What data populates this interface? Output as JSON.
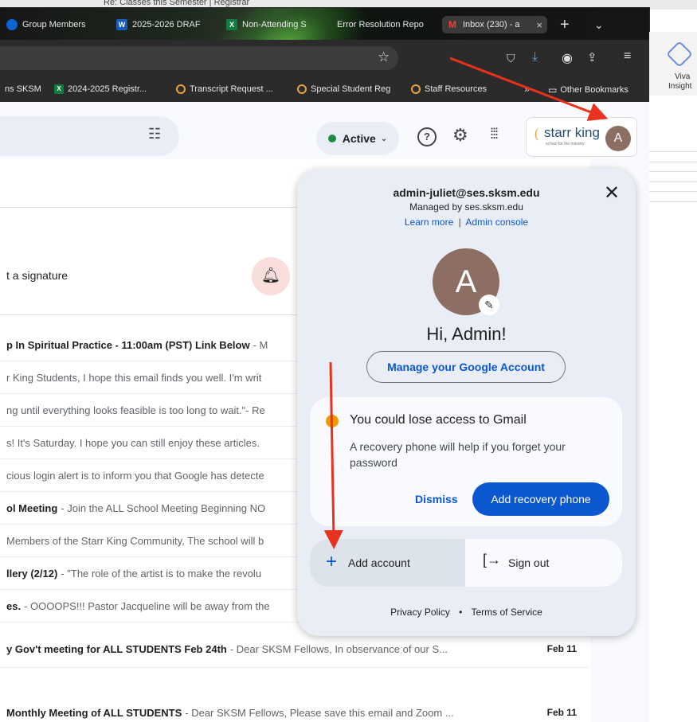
{
  "top_strip_text": "Re: Classes this Semester | Registrar",
  "tabs": [
    {
      "label": "Group Members",
      "icon": "outlook-icon",
      "color": "#0a64d6",
      "letter": ""
    },
    {
      "label": "2025-2026 DRAF",
      "icon": "word-icon",
      "color": "#185abd",
      "letter": "W"
    },
    {
      "label": "Non-Attending S",
      "icon": "excel-icon",
      "color": "#107c41",
      "letter": "X"
    },
    {
      "label": "Error Resolution Repo",
      "icon": "",
      "color": "",
      "letter": ""
    },
    {
      "label": "Inbox (230) - a",
      "icon": "gmail-icon",
      "color": "#ea4335",
      "letter": "M"
    }
  ],
  "bookmarks": [
    {
      "label": "ns SKSM",
      "icon": ""
    },
    {
      "label": "2024-2025 Registr...",
      "icon": "excel-icon",
      "letter": "X",
      "color": "#107c41"
    },
    {
      "label": "Transcript Request ...",
      "icon": "sksm-icon",
      "letter": "",
      "color": "#e8a33d"
    },
    {
      "label": "Special Student Reg",
      "icon": "sksm-icon",
      "letter": "",
      "color": "#e8a33d"
    },
    {
      "label": "Staff Resources",
      "icon": "sksm-icon",
      "letter": "",
      "color": "#e8a33d"
    },
    {
      "label": "Other Bookmarks",
      "icon": "folder-icon"
    }
  ],
  "viva": {
    "line1": "Viva",
    "line2": "Insight"
  },
  "header": {
    "status": "Active",
    "org_name": "starr king",
    "org_tagline": "school for the ministry",
    "avatar_letter": "A"
  },
  "signature_prompt": "t a signature",
  "emails": [
    {
      "subject": "p In Spiritual Practice - 11:00am (PST) Link Below",
      "snippet": " - M",
      "date": ""
    },
    {
      "subject": "",
      "snippet": "r King Students, I hope this email finds you well. I'm writ",
      "date": ""
    },
    {
      "subject": "",
      "snippet": "ng until everything looks feasible is too long to wait.\"- Re",
      "date": ""
    },
    {
      "subject": "",
      "snippet": "s! It's Saturday. I hope you can still enjoy these articles.",
      "date": ""
    },
    {
      "subject": "",
      "snippet": "cious login alert is to inform you that Google has detecte",
      "date": ""
    },
    {
      "subject": "ol Meeting",
      "snippet": " - Join the ALL School Meeting Beginning NO",
      "date": ""
    },
    {
      "subject": "",
      "snippet": " Members of the Starr King Community, The school will b",
      "date": ""
    },
    {
      "subject": "llery (2/12)",
      "snippet": " - \"The role of the artist is to make the revolu",
      "date": ""
    },
    {
      "subject": "es.",
      "snippet": " - OOOOPS!!! Pastor Jacqueline will be away from the",
      "date": ""
    },
    {
      "subject": "y Gov't meeting for ALL STUDENTS Feb 24th",
      "snippet": " - Dear SKSM Fellows, In observance of our S...",
      "date": "Feb 11"
    },
    {
      "subject": "Monthly Meeting of ALL STUDENTS",
      "snippet": " - Dear SKSM Fellows, Please save this email and Zoom ...",
      "date": "Feb 11"
    }
  ],
  "popup": {
    "email": "admin-juliet@ses.sksm.edu",
    "managed_by": "Managed by ses.sksm.edu",
    "learn_more": "Learn more",
    "separator": "|",
    "admin_console": "Admin console",
    "avatar_letter": "A",
    "greeting": "Hi, Admin!",
    "manage_button": "Manage your Google Account",
    "warning_title": "You could lose access to Gmail",
    "warning_body": "A recovery phone will help if you forget your password",
    "dismiss": "Dismiss",
    "add_recovery": "Add recovery phone",
    "add_account": "Add account",
    "sign_out": "Sign out",
    "privacy": "Privacy Policy",
    "dot": "•",
    "terms": "Terms of Service"
  },
  "colors": {
    "accent_blue": "#0b57d0",
    "avatar_brown": "#8d6e63",
    "warning_orange": "#f29900",
    "active_green": "#1e8e3e",
    "annotation_red": "#e8321e"
  }
}
